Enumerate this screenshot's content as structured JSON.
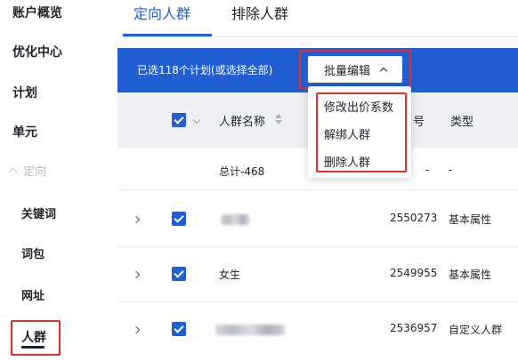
{
  "sidebar": {
    "items": [
      {
        "label": "账户概览"
      },
      {
        "label": "优化中心"
      },
      {
        "label": "计划"
      },
      {
        "label": "单元"
      }
    ],
    "group_label": "定向",
    "sub_items": [
      {
        "label": "关键词"
      },
      {
        "label": "词包"
      },
      {
        "label": "网址"
      },
      {
        "label": "人群"
      }
    ],
    "active_item": "人群"
  },
  "tabs": [
    {
      "label": "定向人群",
      "active": true
    },
    {
      "label": "排除人群",
      "active": false
    }
  ],
  "batch_bar": {
    "selection_text": "已选118个计划(或选择全部)",
    "batch_edit_label": "批量编辑"
  },
  "dropdown": {
    "items": [
      {
        "label": "修改出价系数"
      },
      {
        "label": "解绑人群"
      },
      {
        "label": "删除人群"
      }
    ]
  },
  "table": {
    "columns": {
      "name": "人群名称",
      "id_partial": "号",
      "type": "类型"
    },
    "summary": {
      "name": "总计-468",
      "id": "-",
      "type": "-"
    },
    "rows": [
      {
        "name": "",
        "id": "2550273",
        "type": "基本属性",
        "checked": true
      },
      {
        "name": "女生",
        "id": "2549955",
        "type": "基本属性",
        "checked": true
      },
      {
        "name": "",
        "id": "2536957",
        "type": "自定义人群",
        "checked": true
      }
    ]
  },
  "colors": {
    "accent": "#1f5fd2",
    "highlight": "#e0302e"
  }
}
